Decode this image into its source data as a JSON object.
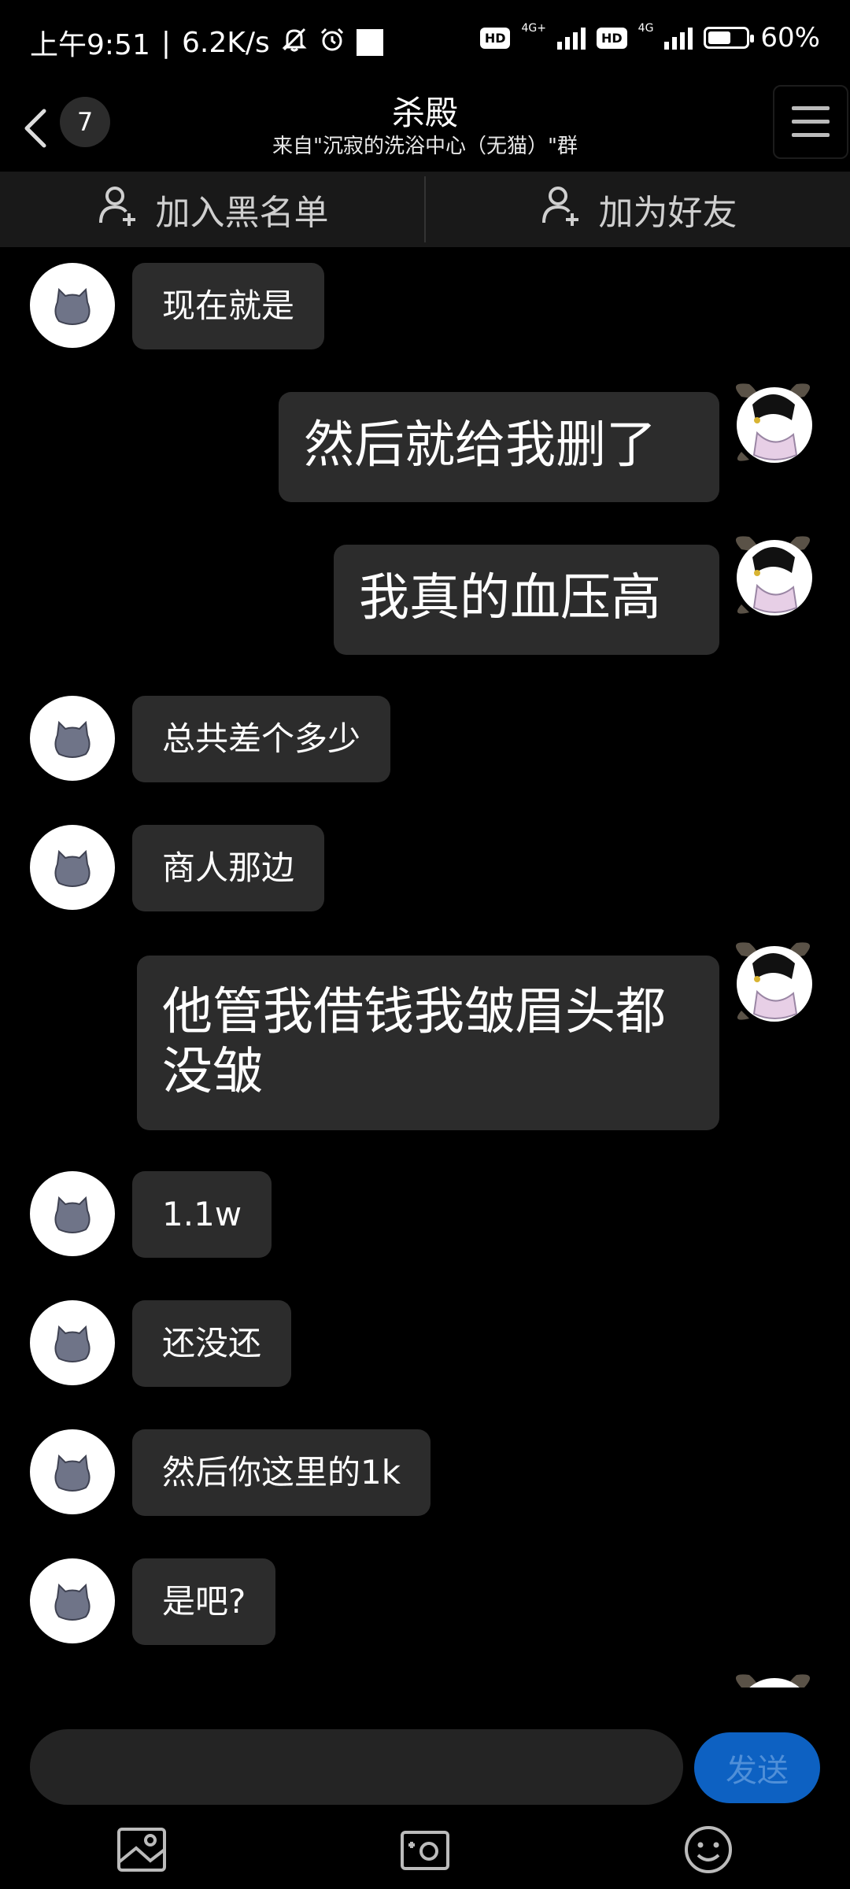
{
  "status_bar": {
    "time": "上午9:51",
    "separator": "|",
    "speed": "6.2K/s",
    "hd1": "HD",
    "net1": "4G+",
    "hd2": "HD",
    "net2": "4G",
    "battery_level": 60,
    "battery": "60%"
  },
  "header": {
    "back_badge": "7",
    "title": "杀殿",
    "subtitle": "来自\"沉寂的洗浴中心（无猫）\"群"
  },
  "actions": {
    "block_label": "加入黑名单",
    "add_friend_label": "加为好友"
  },
  "messages": [
    {
      "side": "left",
      "text": "现在就是"
    },
    {
      "side": "right",
      "text": "然后就给我删了"
    },
    {
      "side": "right",
      "text": "我真的血压高"
    },
    {
      "side": "left",
      "text": "总共差个多少"
    },
    {
      "side": "left",
      "text": "商人那边"
    },
    {
      "side": "right",
      "text": "他管我借钱我皱眉头都没皱"
    },
    {
      "side": "left",
      "text": "1.1w"
    },
    {
      "side": "left",
      "text": "还没还"
    },
    {
      "side": "left",
      "text": "然后你这里的1k"
    },
    {
      "side": "left",
      "text": "是吧?"
    }
  ],
  "input": {
    "placeholder": "",
    "send_label": "发送"
  },
  "toolbar": [
    "image-icon",
    "camera-icon",
    "emoji-icon"
  ],
  "colors": {
    "background": "#000000",
    "bubble": "#2c2c2c",
    "send": "#0d61c2"
  }
}
